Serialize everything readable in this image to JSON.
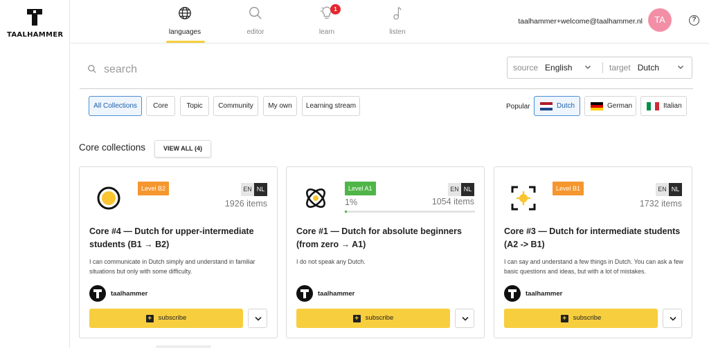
{
  "brand": {
    "name": "TAALHAMMER"
  },
  "nav": {
    "items": [
      {
        "label": "languages",
        "icon": "globe-icon",
        "active": true
      },
      {
        "label": "editor",
        "icon": "search-icon"
      },
      {
        "label": "learn",
        "icon": "lightbulb-icon",
        "badge": "1"
      },
      {
        "label": "listen",
        "icon": "music-note-icon"
      }
    ]
  },
  "user": {
    "email": "taalhammer+welcome@taalhammer.nl",
    "initials": "TA"
  },
  "search": {
    "placeholder": "search"
  },
  "languages": {
    "source_label": "source",
    "source_value": "English",
    "target_label": "target",
    "target_value": "Dutch"
  },
  "filters": [
    "All Collections",
    "Core",
    "Topic",
    "Community",
    "My own",
    "Learning stream"
  ],
  "popular": {
    "label": "Popular",
    "items": [
      {
        "label": "Dutch",
        "active": true
      },
      {
        "label": "German"
      },
      {
        "label": "Italian"
      }
    ]
  },
  "section": {
    "title": "Core collections",
    "view_all": "VIEW ALL (4)"
  },
  "cards": [
    {
      "icon": "target-circle-icon",
      "level": "Level B2",
      "source": "EN",
      "target": "NL",
      "items": "1926 items",
      "title": "Core #4 — Dutch for upper-intermediate students (B1 → B2)",
      "description": "I can communicate in Dutch simply and understand in familiar situations but only with some difficulty.",
      "author": "taalhammer",
      "subscribe": "subscribe"
    },
    {
      "icon": "atom-icon",
      "level": "Level A1",
      "source": "EN",
      "target": "NL",
      "progress_text": "1%",
      "progress": 0.01,
      "items": "1054 items",
      "title": "Core #1 — Dutch for absolute beginners (from zero → A1)",
      "description": "I do not speak any Dutch.",
      "author": "taalhammer",
      "subscribe": "subscribe"
    },
    {
      "icon": "focus-target-icon",
      "level": "Level B1",
      "source": "EN",
      "target": "NL",
      "items": "1732 items",
      "title": "Core #3 — Dutch for intermediate students (A2 -> B1)",
      "description": "I can say and understand a few things in Dutch. You can ask a few basic questions and ideas, but with a lot of mistakes.",
      "author": "taalhammer",
      "subscribe": "subscribe"
    }
  ],
  "colors": {
    "accent": "#f7ce3e",
    "badge": "#e4262f",
    "avatar": "#f28fa6",
    "level_a1": "#4fb548",
    "level_b": "#f5962e"
  }
}
